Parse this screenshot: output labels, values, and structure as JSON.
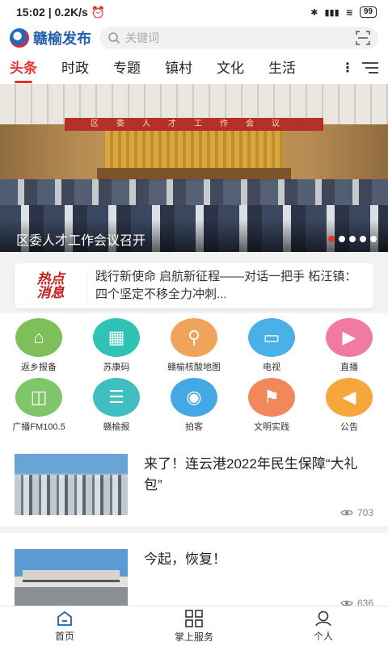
{
  "status_bar": {
    "time": "15:02",
    "speed": "0.2K/s",
    "battery": "99"
  },
  "header": {
    "app_name": "赣榆发布",
    "search_placeholder": "关键词"
  },
  "tabs": [
    {
      "label": "头条",
      "active": true
    },
    {
      "label": "时政"
    },
    {
      "label": "专题"
    },
    {
      "label": "镇村"
    },
    {
      "label": "文化"
    },
    {
      "label": "生活"
    }
  ],
  "banner": {
    "caption": "区委人才工作会议召开",
    "hall_banner_text": "区委人才工作会议",
    "slide_count": 5,
    "active_slide": 1
  },
  "hot_news": {
    "badge_line1": "热点",
    "badge_line2": "消息",
    "text": "践行新使命 启航新征程——对话一把手 柘汪镇：四个坚定不移全力冲刺..."
  },
  "services": [
    {
      "label": "返乡报备",
      "icon": "farmhouse-icon",
      "color": "#7fbf5a"
    },
    {
      "label": "苏康码",
      "icon": "health-code-icon",
      "color": "#2fc3b5"
    },
    {
      "label": "赣榆核酸地图",
      "icon": "map-pin-icon",
      "color": "#f0a45a"
    },
    {
      "label": "电视",
      "icon": "tv-icon",
      "color": "#4ab0e8"
    },
    {
      "label": "直播",
      "icon": "video-play-icon",
      "color": "#f07aa0"
    },
    {
      "label": "广播FM100.5",
      "icon": "radio-icon",
      "color": "#7fc56a"
    },
    {
      "label": "赣榆报",
      "icon": "newspaper-icon",
      "color": "#3fbfbf"
    },
    {
      "label": "拍客",
      "icon": "camera-icon",
      "color": "#45a8e6"
    },
    {
      "label": "文明实践",
      "icon": "flag-icon",
      "color": "#f0885a"
    },
    {
      "label": "公告",
      "icon": "megaphone-icon",
      "color": "#f6a63a"
    }
  ],
  "news": [
    {
      "title": "来了！连云港2022年民生保障“大礼包”",
      "views": "703"
    },
    {
      "title": "今起，恢复！",
      "views": "636"
    }
  ],
  "bottom_nav": [
    {
      "label": "首页",
      "icon": "home-icon",
      "active": true
    },
    {
      "label": "掌上服务",
      "icon": "grid-icon"
    },
    {
      "label": "个人",
      "icon": "user-icon"
    }
  ],
  "colors": {
    "accent": "#e5322d",
    "brand": "#1f5fae"
  }
}
